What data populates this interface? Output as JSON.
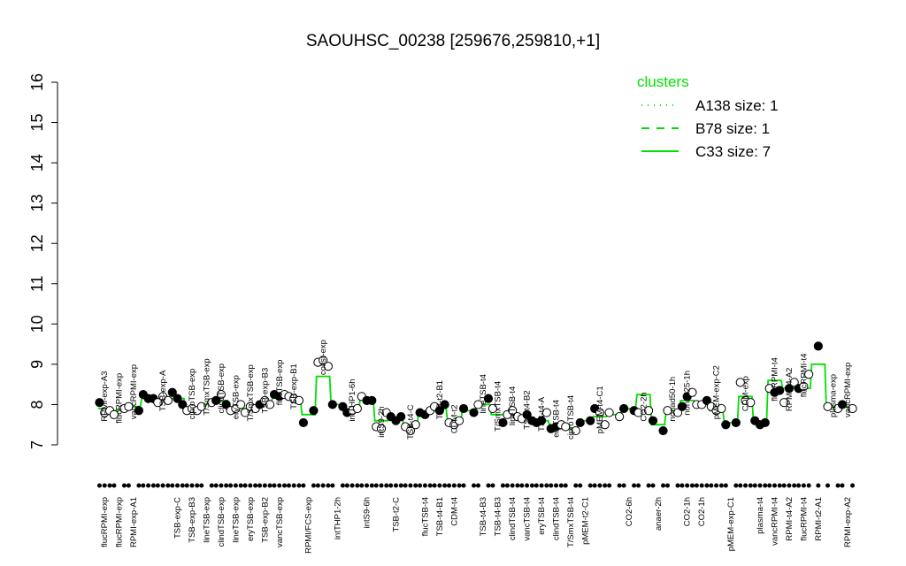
{
  "chart_data": {
    "type": "scatter",
    "title": "SAOUHSC_00238 [259676,259810,+1]",
    "ylim": [
      7,
      16
    ],
    "yticks": [
      7,
      8,
      9,
      10,
      11,
      12,
      13,
      14,
      15,
      16
    ],
    "line_color": "#00e000",
    "legend": {
      "title": "clusters",
      "placement": "top-right",
      "entries": [
        {
          "label": "A138 size: 1",
          "style": "dotted"
        },
        {
          "label": "B78 size: 1",
          "style": "dashed"
        },
        {
          "label": "C33 size: 7",
          "style": "solid"
        }
      ]
    },
    "groups": [
      {
        "top": "RPMI-exp-A3",
        "bottom": "flucRPMI-exp",
        "values": [
          8.05,
          7.8,
          7.85
        ],
        "filled": [
          true,
          false,
          false
        ],
        "line": 7.9
      },
      {
        "top": "flucRPMI-exp",
        "bottom": "flucRPMI-exp",
        "values": [
          7.75,
          7.9
        ],
        "filled": [
          false,
          false
        ],
        "line": 7.85
      },
      {
        "top": "vancRPMI-exp",
        "bottom": "RPMI-exp-A1",
        "values": [
          7.95,
          7.85
        ],
        "filled": [
          false,
          true
        ],
        "line": 7.95
      },
      {
        "top": "",
        "bottom": "",
        "values": [
          8.25,
          8.15,
          8.15
        ],
        "filled": [
          true,
          true,
          true
        ],
        "line": 8.15
      },
      {
        "top": "TSB-exp-A",
        "bottom": "",
        "values": [
          8.05,
          8.2,
          8.1
        ],
        "filled": [
          false,
          false,
          false
        ],
        "line": 8.1
      },
      {
        "top": "",
        "bottom": "TSB-exp-C",
        "values": [
          8.3,
          8.15,
          8.0
        ],
        "filled": [
          true,
          true,
          true
        ],
        "line": 8.15
      },
      {
        "top": "ciproTSB-exp",
        "bottom": "TSB-exp-B3",
        "values": [
          7.85,
          7.9,
          7.85
        ],
        "filled": [
          false,
          false,
          false
        ],
        "line": 7.9
      },
      {
        "top": "T/SmxTSB-exp",
        "bottom": "lineTSB-exp",
        "values": [
          7.95,
          8.05
        ],
        "filled": [
          false,
          false
        ],
        "line": 8.0
      },
      {
        "top": "clindTSB-exp",
        "bottom": "clindTSB-exp",
        "values": [
          8.1,
          8.25,
          8.0
        ],
        "filled": [
          true,
          false,
          true
        ],
        "line": 8.1
      },
      {
        "top": "eryTSB-exp",
        "bottom": "lineTSB-exp",
        "values": [
          7.85,
          7.9,
          8.0
        ],
        "filled": [
          false,
          false,
          false
        ],
        "line": 7.9
      },
      {
        "top": "T/SmxTSB-exp",
        "bottom": "eryTSB-exp",
        "values": [
          7.8,
          7.95,
          7.9
        ],
        "filled": [
          false,
          false,
          false
        ],
        "line": 7.9
      },
      {
        "top": "TSB-exp-B3",
        "bottom": "TSB-exp-B2",
        "values": [
          8.0,
          8.1,
          8.0
        ],
        "filled": [
          true,
          false,
          false
        ],
        "line": 8.05
      },
      {
        "top": "flucTSB-exp",
        "bottom": "vancTSB-exp",
        "values": [
          8.25,
          8.2,
          8.25
        ],
        "filled": [
          true,
          true,
          false
        ],
        "line": 8.2
      },
      {
        "top": "TSB-exp-B1",
        "bottom": "",
        "values": [
          8.2,
          8.15,
          8.1
        ],
        "filled": [
          false,
          false,
          false
        ],
        "line": 8.15
      },
      {
        "top": "",
        "bottom": "RPMI/FCS-exp",
        "values": [
          7.55,
          7.85
        ],
        "filled": [
          true,
          true
        ],
        "line": 7.75
      },
      {
        "top": "colist-exp",
        "bottom": "",
        "values": [
          9.05,
          9.1,
          8.95
        ],
        "filled": [
          false,
          false,
          false
        ],
        "line": 8.7
      },
      {
        "top": "",
        "bottom": "intTHP1-2h",
        "values": [
          8.0,
          7.95
        ],
        "filled": [
          true,
          true
        ],
        "line": 8.0
      },
      {
        "top": "intTHP1-6h",
        "bottom": "",
        "values": [
          7.8,
          7.85,
          7.9
        ],
        "filled": [
          true,
          false,
          false
        ],
        "line": 7.85
      },
      {
        "top": "",
        "bottom": "intS9-6h",
        "values": [
          8.2,
          8.1,
          8.1
        ],
        "filled": [
          false,
          true,
          true
        ],
        "line": 8.15
      },
      {
        "top": "intS9-2h",
        "bottom": "",
        "values": [
          7.45,
          7.4,
          7.8
        ],
        "filled": [
          false,
          false,
          false
        ],
        "line": 7.6
      },
      {
        "top": "",
        "bottom": "TSB-t2-C",
        "values": [
          7.7,
          7.6,
          7.7
        ],
        "filled": [
          true,
          true,
          true
        ],
        "line": 7.65
      },
      {
        "top": "TSB-t4-C",
        "bottom": "",
        "values": [
          7.45,
          7.35,
          7.5
        ],
        "filled": [
          false,
          false,
          false
        ],
        "line": 7.45
      },
      {
        "top": "",
        "bottom": "flucTSB-t4",
        "values": [
          7.8,
          7.75,
          7.85
        ],
        "filled": [
          true,
          true,
          false
        ],
        "line": 7.8
      },
      {
        "top": "TSB-t2-B1",
        "bottom": "TSB-t4-B1",
        "values": [
          7.95,
          7.85,
          8.0
        ],
        "filled": [
          false,
          true,
          true
        ],
        "line": 7.9
      },
      {
        "top": "CDM-t2",
        "bottom": "CDM-t4",
        "values": [
          7.55,
          7.5,
          7.6
        ],
        "filled": [
          false,
          false,
          false
        ],
        "line": 7.55
      },
      {
        "top": "",
        "bottom": "",
        "values": [
          7.9,
          7.8
        ],
        "filled": [
          true,
          true
        ],
        "line": 7.85
      },
      {
        "top": "lineTSB-t4",
        "bottom": "TSB-t4-B3",
        "values": [
          8.0,
          8.15
        ],
        "filled": [
          false,
          true
        ],
        "line": 8.0
      },
      {
        "top": "T/SmxTSB-t4",
        "bottom": "TSB-t4-B3",
        "values": [
          7.9,
          7.55
        ],
        "filled": [
          false,
          true
        ],
        "line": 7.75
      },
      {
        "top": "lineTSB-t4",
        "bottom": "clindTSB-t4",
        "values": [
          7.75,
          7.85,
          7.7
        ],
        "filled": [
          false,
          false,
          false
        ],
        "line": 7.75
      },
      {
        "top": "TSB-t4-B2",
        "bottom": "vancTSB-t4",
        "values": [
          7.65,
          7.75,
          7.6
        ],
        "filled": [
          false,
          true,
          true
        ],
        "line": 7.65
      },
      {
        "top": "TSB-t4-A",
        "bottom": "eryTSB-t4",
        "values": [
          7.55,
          7.6,
          7.8
        ],
        "filled": [
          true,
          true,
          false
        ],
        "line": 7.6
      },
      {
        "top": "eryTSB-t4",
        "bottom": "clindTSB-t4",
        "values": [
          7.4,
          7.45,
          7.5
        ],
        "filled": [
          true,
          true,
          false
        ],
        "line": 7.5
      },
      {
        "top": "ciproTSB-t4",
        "bottom": "T/SmxTSB-t4",
        "values": [
          7.45,
          7.35
        ],
        "filled": [
          false,
          false
        ],
        "line": 7.4
      },
      {
        "top": "",
        "bottom": "pMEM-t2-C1",
        "values": [
          7.55,
          7.6
        ],
        "filled": [
          true,
          true
        ],
        "line": 7.6
      },
      {
        "top": "pMEM-t4-C1",
        "bottom": "",
        "values": [
          7.9,
          7.8,
          7.5
        ],
        "filled": [
          true,
          false,
          false
        ],
        "line": 7.7
      },
      {
        "top": "",
        "bottom": "",
        "values": [
          7.8,
          7.7
        ],
        "filled": [
          false,
          false
        ],
        "line": 7.75
      },
      {
        "top": "",
        "bottom": "CO2-6h",
        "values": [
          7.9,
          7.85
        ],
        "filled": [
          true,
          true
        ],
        "line": 7.9
      },
      {
        "top": "CO2-2h",
        "bottom": "",
        "values": [
          7.8,
          7.85
        ],
        "filled": [
          false,
          false
        ],
        "line": 8.25
      },
      {
        "top": "",
        "bottom": "anaer-2h",
        "values": [
          7.6,
          7.35
        ],
        "filled": [
          true,
          true
        ],
        "line": 7.5
      },
      {
        "top": "nonad50-1h",
        "bottom": "",
        "values": [
          7.85,
          7.8
        ],
        "filled": [
          false,
          false
        ],
        "line": 7.85
      },
      {
        "top": "nonad25-1h",
        "bottom": "CO2-1h",
        "values": [
          7.95,
          8.2,
          8.3
        ],
        "filled": [
          true,
          true,
          false
        ],
        "line": 8.1
      },
      {
        "top": "",
        "bottom": "CO2-1h",
        "values": [
          8.0,
          8.0,
          8.1
        ],
        "filled": [
          false,
          false,
          true
        ],
        "line": 8.0
      },
      {
        "top": "pMEM-exp-C2",
        "bottom": "",
        "values": [
          7.95,
          7.85,
          7.9
        ],
        "filled": [
          false,
          false,
          false
        ],
        "line": 7.85
      },
      {
        "top": "",
        "bottom": "pMEM-exp-C1",
        "values": [
          7.5,
          7.55
        ],
        "filled": [
          true,
          true
        ],
        "line": 7.55
      },
      {
        "top": "CDM-exp",
        "bottom": "",
        "values": [
          8.55,
          8.1,
          8.05
        ],
        "filled": [
          false,
          false,
          false
        ],
        "line": 8.2
      },
      {
        "top": "",
        "bottom": "plasma-t4",
        "values": [
          7.6,
          7.5,
          7.55
        ],
        "filled": [
          true,
          true,
          true
        ],
        "line": 7.55
      },
      {
        "top": "flucRPMI-t4",
        "bottom": "vancRPMI-t4",
        "values": [
          8.4,
          8.3,
          8.35
        ],
        "filled": [
          false,
          true,
          true
        ],
        "line": 8.6
      },
      {
        "top": "RPMI-t4-A2",
        "bottom": "RPMI-t4-A2",
        "values": [
          8.05,
          8.4,
          8.55
        ],
        "filled": [
          false,
          true,
          false
        ],
        "line": 8.4
      },
      {
        "top": "flucRPMI-t4",
        "bottom": "flucRPMI-t4",
        "values": [
          8.4,
          8.45,
          8.75
        ],
        "filled": [
          true,
          false,
          false
        ],
        "line": 8.4
      },
      {
        "top": "",
        "bottom": "RPMI-t2-A1",
        "values": [
          9.45
        ],
        "filled": [
          true
        ],
        "line": 9.0
      },
      {
        "top": "plasma-exp",
        "bottom": "",
        "values": [
          7.95,
          7.9
        ],
        "filled": [
          false,
          false
        ],
        "line": 7.95
      },
      {
        "top": "vancRPMI-exp",
        "bottom": "RPMI-exp-A2",
        "values": [
          8.0,
          7.9
        ],
        "filled": [
          true,
          false
        ],
        "line": 7.95
      }
    ]
  }
}
